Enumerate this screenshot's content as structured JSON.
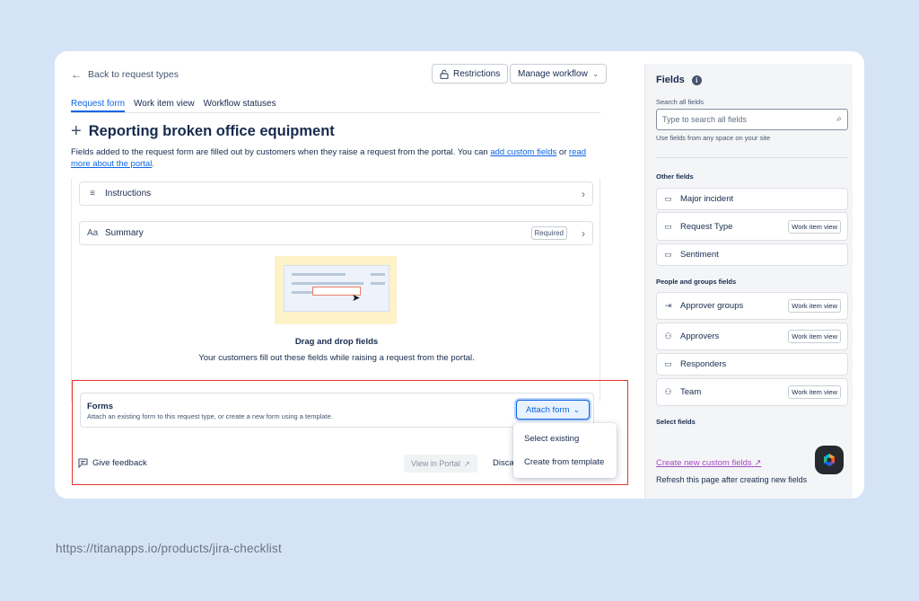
{
  "back_link": "Back to request types",
  "toolbar": {
    "restrictions": "Restrictions",
    "manage_workflow": "Manage workflow"
  },
  "tabs": [
    {
      "label": "Request form",
      "active": true
    },
    {
      "label": "Work item view",
      "active": false
    },
    {
      "label": "Workflow statuses",
      "active": false
    }
  ],
  "title": "Reporting broken office equipment",
  "description": {
    "text1": "Fields added to the request form are filled out by customers when they raise a request from the portal. You can ",
    "link1": "add custom fields",
    "text2": " or ",
    "link2": "read more about the portal",
    "text3": "."
  },
  "fields": [
    {
      "icon": "≡",
      "label": "Instructions",
      "required": ""
    },
    {
      "icon": "Aa",
      "label": "Summary",
      "required": "Required"
    }
  ],
  "dropzone": {
    "title": "Drag and drop fields",
    "subtitle": "Your customers fill out these fields while raising a request from the portal."
  },
  "forms": {
    "title": "Forms",
    "description": "Attach an existing form to this request type, or create a new form using a template.",
    "attach_button": "Attach form",
    "menu": [
      "Select existing",
      "Create from template"
    ]
  },
  "footer_actions": {
    "feedback": "Give feedback",
    "view_portal": "View in Portal",
    "discard": "Discar"
  },
  "panel": {
    "title": "Fields",
    "search_label": "Search all fields",
    "search_placeholder": "Type to search all fields",
    "search_hint": "Use fields from any space on your site",
    "other_heading": "Other fields",
    "other_fields": [
      {
        "icon": "folder-icon",
        "label": "Major incident",
        "badge": ""
      },
      {
        "icon": "folder-icon",
        "label": "Request Type",
        "badge": "Work item view"
      },
      {
        "icon": "folder-icon",
        "label": "Sentiment",
        "badge": ""
      }
    ],
    "people_heading": "People and groups fields",
    "people_fields": [
      {
        "icon": "approver-groups-icon",
        "label": "Approver groups",
        "badge": "Work item view"
      },
      {
        "icon": "person-icon",
        "label": "Approvers",
        "badge": "Work item view"
      },
      {
        "icon": "folder-icon",
        "label": "Responders",
        "badge": ""
      },
      {
        "icon": "team-icon",
        "label": "Team",
        "badge": "Work item view"
      }
    ],
    "select_heading": "Select fields",
    "custom_link": "Create new custom fields",
    "refresh_text": "Refresh this page after creating new fields"
  },
  "footer_url": "https://titanapps.io/products/jira-checklist",
  "colors": {
    "accent": "#0c66e4",
    "highlight_border": "#e2352a",
    "background": "#d5e3f7"
  }
}
